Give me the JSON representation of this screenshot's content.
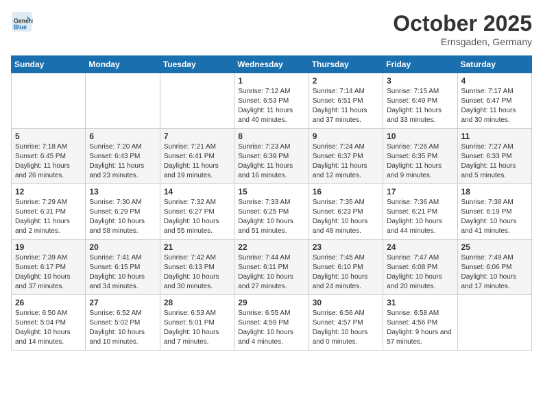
{
  "header": {
    "logo_general": "General",
    "logo_blue": "Blue",
    "month_title": "October 2025",
    "location": "Ernsgaden, Germany"
  },
  "weekdays": [
    "Sunday",
    "Monday",
    "Tuesday",
    "Wednesday",
    "Thursday",
    "Friday",
    "Saturday"
  ],
  "weeks": [
    [
      {
        "day": "",
        "info": ""
      },
      {
        "day": "",
        "info": ""
      },
      {
        "day": "",
        "info": ""
      },
      {
        "day": "1",
        "info": "Sunrise: 7:12 AM\nSunset: 6:53 PM\nDaylight: 11 hours and 40 minutes."
      },
      {
        "day": "2",
        "info": "Sunrise: 7:14 AM\nSunset: 6:51 PM\nDaylight: 11 hours and 37 minutes."
      },
      {
        "day": "3",
        "info": "Sunrise: 7:15 AM\nSunset: 6:49 PM\nDaylight: 11 hours and 33 minutes."
      },
      {
        "day": "4",
        "info": "Sunrise: 7:17 AM\nSunset: 6:47 PM\nDaylight: 11 hours and 30 minutes."
      }
    ],
    [
      {
        "day": "5",
        "info": "Sunrise: 7:18 AM\nSunset: 6:45 PM\nDaylight: 11 hours and 26 minutes."
      },
      {
        "day": "6",
        "info": "Sunrise: 7:20 AM\nSunset: 6:43 PM\nDaylight: 11 hours and 23 minutes."
      },
      {
        "day": "7",
        "info": "Sunrise: 7:21 AM\nSunset: 6:41 PM\nDaylight: 11 hours and 19 minutes."
      },
      {
        "day": "8",
        "info": "Sunrise: 7:23 AM\nSunset: 6:39 PM\nDaylight: 11 hours and 16 minutes."
      },
      {
        "day": "9",
        "info": "Sunrise: 7:24 AM\nSunset: 6:37 PM\nDaylight: 11 hours and 12 minutes."
      },
      {
        "day": "10",
        "info": "Sunrise: 7:26 AM\nSunset: 6:35 PM\nDaylight: 11 hours and 9 minutes."
      },
      {
        "day": "11",
        "info": "Sunrise: 7:27 AM\nSunset: 6:33 PM\nDaylight: 11 hours and 5 minutes."
      }
    ],
    [
      {
        "day": "12",
        "info": "Sunrise: 7:29 AM\nSunset: 6:31 PM\nDaylight: 11 hours and 2 minutes."
      },
      {
        "day": "13",
        "info": "Sunrise: 7:30 AM\nSunset: 6:29 PM\nDaylight: 10 hours and 58 minutes."
      },
      {
        "day": "14",
        "info": "Sunrise: 7:32 AM\nSunset: 6:27 PM\nDaylight: 10 hours and 55 minutes."
      },
      {
        "day": "15",
        "info": "Sunrise: 7:33 AM\nSunset: 6:25 PM\nDaylight: 10 hours and 51 minutes."
      },
      {
        "day": "16",
        "info": "Sunrise: 7:35 AM\nSunset: 6:23 PM\nDaylight: 10 hours and 48 minutes."
      },
      {
        "day": "17",
        "info": "Sunrise: 7:36 AM\nSunset: 6:21 PM\nDaylight: 10 hours and 44 minutes."
      },
      {
        "day": "18",
        "info": "Sunrise: 7:38 AM\nSunset: 6:19 PM\nDaylight: 10 hours and 41 minutes."
      }
    ],
    [
      {
        "day": "19",
        "info": "Sunrise: 7:39 AM\nSunset: 6:17 PM\nDaylight: 10 hours and 37 minutes."
      },
      {
        "day": "20",
        "info": "Sunrise: 7:41 AM\nSunset: 6:15 PM\nDaylight: 10 hours and 34 minutes."
      },
      {
        "day": "21",
        "info": "Sunrise: 7:42 AM\nSunset: 6:13 PM\nDaylight: 10 hours and 30 minutes."
      },
      {
        "day": "22",
        "info": "Sunrise: 7:44 AM\nSunset: 6:11 PM\nDaylight: 10 hours and 27 minutes."
      },
      {
        "day": "23",
        "info": "Sunrise: 7:45 AM\nSunset: 6:10 PM\nDaylight: 10 hours and 24 minutes."
      },
      {
        "day": "24",
        "info": "Sunrise: 7:47 AM\nSunset: 6:08 PM\nDaylight: 10 hours and 20 minutes."
      },
      {
        "day": "25",
        "info": "Sunrise: 7:49 AM\nSunset: 6:06 PM\nDaylight: 10 hours and 17 minutes."
      }
    ],
    [
      {
        "day": "26",
        "info": "Sunrise: 6:50 AM\nSunset: 5:04 PM\nDaylight: 10 hours and 14 minutes."
      },
      {
        "day": "27",
        "info": "Sunrise: 6:52 AM\nSunset: 5:02 PM\nDaylight: 10 hours and 10 minutes."
      },
      {
        "day": "28",
        "info": "Sunrise: 6:53 AM\nSunset: 5:01 PM\nDaylight: 10 hours and 7 minutes."
      },
      {
        "day": "29",
        "info": "Sunrise: 6:55 AM\nSunset: 4:59 PM\nDaylight: 10 hours and 4 minutes."
      },
      {
        "day": "30",
        "info": "Sunrise: 6:56 AM\nSunset: 4:57 PM\nDaylight: 10 hours and 0 minutes."
      },
      {
        "day": "31",
        "info": "Sunrise: 6:58 AM\nSunset: 4:56 PM\nDaylight: 9 hours and 57 minutes."
      },
      {
        "day": "",
        "info": ""
      }
    ]
  ]
}
